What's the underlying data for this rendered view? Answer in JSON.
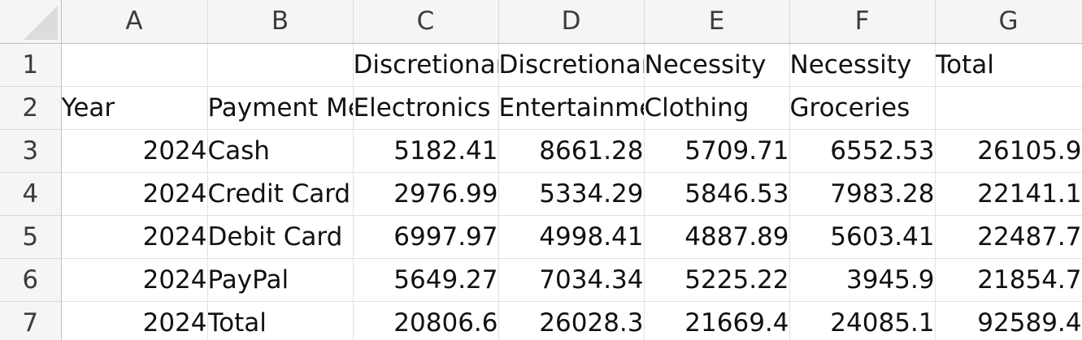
{
  "columns": [
    "A",
    "B",
    "C",
    "D",
    "E",
    "F",
    "G"
  ],
  "rows": [
    {
      "num": "1",
      "cells": [
        {
          "v": "",
          "t": "text"
        },
        {
          "v": "",
          "t": "text"
        },
        {
          "v": "Discretionary",
          "t": "text"
        },
        {
          "v": "Discretionary",
          "t": "text"
        },
        {
          "v": "Necessity",
          "t": "text"
        },
        {
          "v": "Necessity",
          "t": "text"
        },
        {
          "v": "Total",
          "t": "text"
        }
      ]
    },
    {
      "num": "2",
      "cells": [
        {
          "v": "Year",
          "t": "text"
        },
        {
          "v": "Payment Method",
          "t": "text"
        },
        {
          "v": "Electronics",
          "t": "text"
        },
        {
          "v": "Entertainment",
          "t": "text"
        },
        {
          "v": "Clothing",
          "t": "text"
        },
        {
          "v": "Groceries",
          "t": "text"
        },
        {
          "v": "",
          "t": "text"
        }
      ]
    },
    {
      "num": "3",
      "cells": [
        {
          "v": "2024",
          "t": "num"
        },
        {
          "v": "Cash",
          "t": "text"
        },
        {
          "v": "5182.41",
          "t": "num"
        },
        {
          "v": "8661.28",
          "t": "num"
        },
        {
          "v": "5709.71",
          "t": "num"
        },
        {
          "v": "6552.53",
          "t": "num"
        },
        {
          "v": "26105.9",
          "t": "num"
        }
      ]
    },
    {
      "num": "4",
      "cells": [
        {
          "v": "2024",
          "t": "num"
        },
        {
          "v": "Credit Card",
          "t": "text"
        },
        {
          "v": "2976.99",
          "t": "num"
        },
        {
          "v": "5334.29",
          "t": "num"
        },
        {
          "v": "5846.53",
          "t": "num"
        },
        {
          "v": "7983.28",
          "t": "num"
        },
        {
          "v": "22141.1",
          "t": "num"
        }
      ]
    },
    {
      "num": "5",
      "cells": [
        {
          "v": "2024",
          "t": "num"
        },
        {
          "v": "Debit Card",
          "t": "text"
        },
        {
          "v": "6997.97",
          "t": "num"
        },
        {
          "v": "4998.41",
          "t": "num"
        },
        {
          "v": "4887.89",
          "t": "num"
        },
        {
          "v": "5603.41",
          "t": "num"
        },
        {
          "v": "22487.7",
          "t": "num"
        }
      ]
    },
    {
      "num": "6",
      "cells": [
        {
          "v": "2024",
          "t": "num"
        },
        {
          "v": "PayPal",
          "t": "text"
        },
        {
          "v": "5649.27",
          "t": "num"
        },
        {
          "v": "7034.34",
          "t": "num"
        },
        {
          "v": "5225.22",
          "t": "num"
        },
        {
          "v": "3945.9",
          "t": "num"
        },
        {
          "v": "21854.7",
          "t": "num"
        }
      ]
    },
    {
      "num": "7",
      "cells": [
        {
          "v": "2024",
          "t": "num"
        },
        {
          "v": "Total",
          "t": "text"
        },
        {
          "v": "20806.6",
          "t": "num"
        },
        {
          "v": "26028.3",
          "t": "num"
        },
        {
          "v": "21669.4",
          "t": "num"
        },
        {
          "v": "24085.1",
          "t": "num"
        },
        {
          "v": "92589.4",
          "t": "num"
        }
      ]
    }
  ]
}
